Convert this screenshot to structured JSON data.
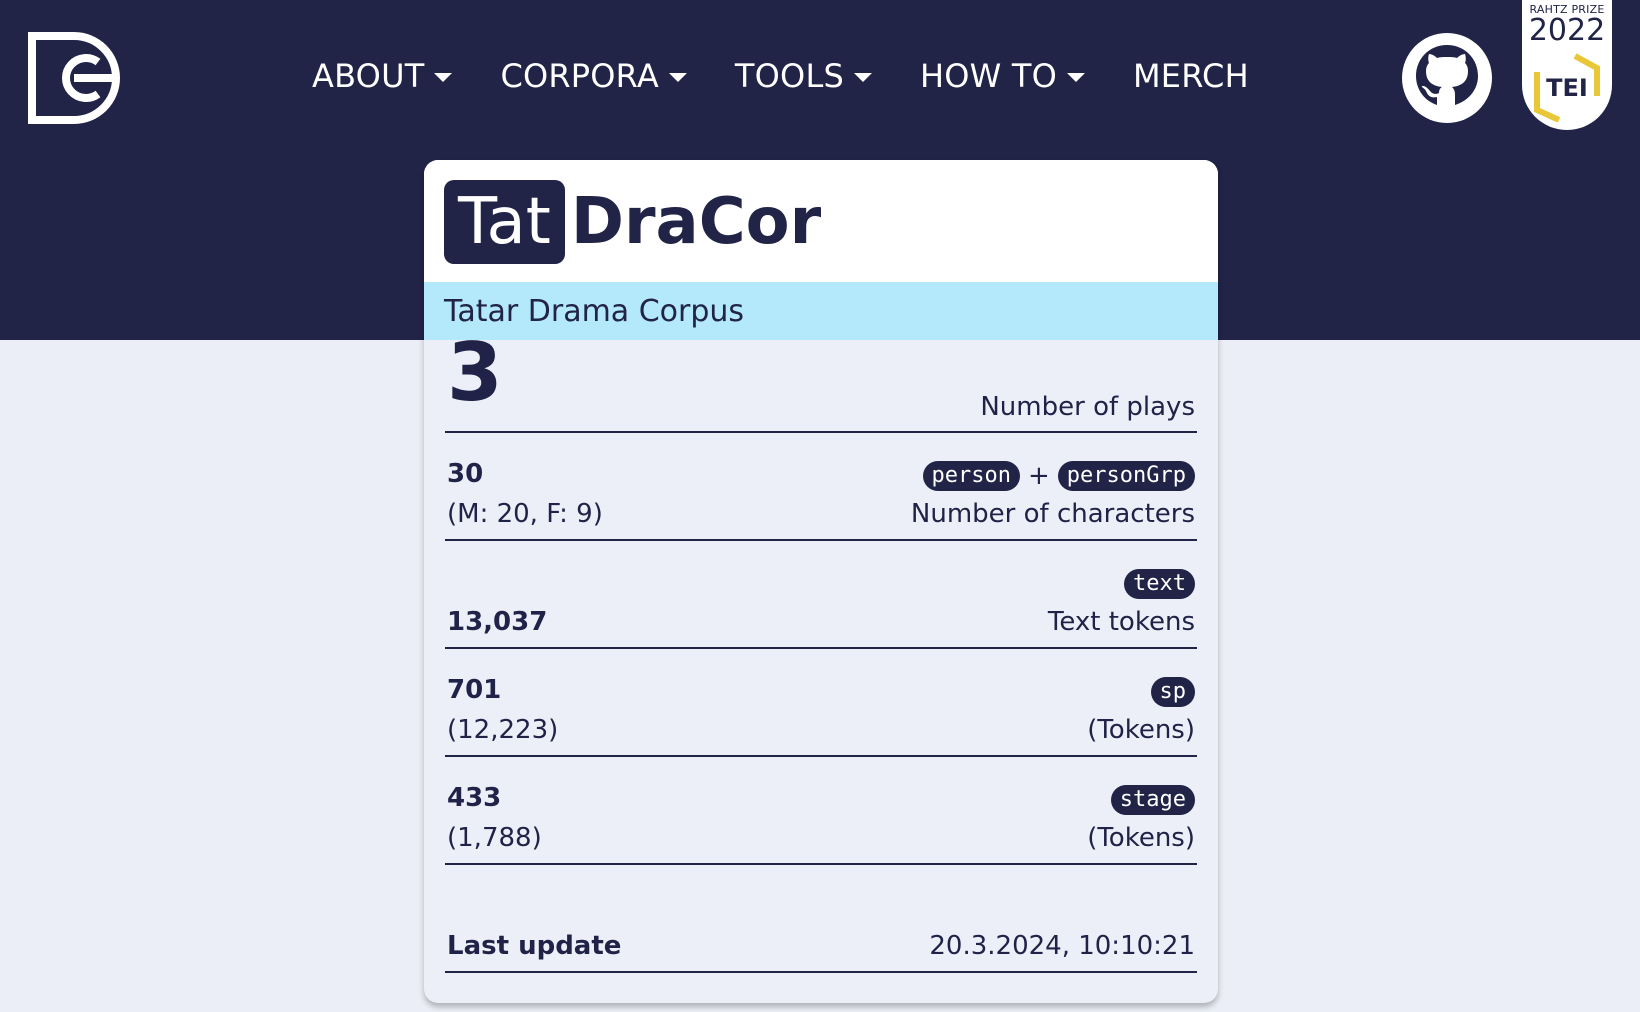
{
  "header": {
    "nav": [
      {
        "label": "ABOUT",
        "dropdown": true
      },
      {
        "label": "CORPORA",
        "dropdown": true
      },
      {
        "label": "TOOLS",
        "dropdown": true
      },
      {
        "label": "HOW TO",
        "dropdown": true
      },
      {
        "label": "MERCH",
        "dropdown": false
      }
    ],
    "logo_icon": "dracor-logo-icon",
    "github_icon": "github-icon",
    "badge": {
      "top": "RAHTZ PRIZE",
      "year": "2022",
      "logo_text": "TEI"
    }
  },
  "card": {
    "brand_box": "Tat",
    "brand_rest": "DraCor",
    "subtitle": "Tatar Drama Corpus",
    "plays": {
      "value": "3",
      "label": "Number of plays"
    },
    "characters": {
      "value": "30",
      "detail": "(M: 20, F: 9)",
      "tag1": "person",
      "plus": "+",
      "tag2": "personGrp",
      "label": "Number of characters"
    },
    "text_tokens": {
      "value": "13,037",
      "tag": "text",
      "label": "Text tokens"
    },
    "sp": {
      "value": "701",
      "detail": "(12,223)",
      "tag": "sp",
      "label": "(Tokens)"
    },
    "stage": {
      "value": "433",
      "detail": "(1,788)",
      "tag": "stage",
      "label": "(Tokens)"
    },
    "last_update": {
      "label": "Last update",
      "value": "20.3.2024, 10:10:21"
    }
  },
  "colors": {
    "navy": "#212347",
    "subtitle_bg": "#b4e8fb",
    "page_bg": "#ebeef6"
  }
}
